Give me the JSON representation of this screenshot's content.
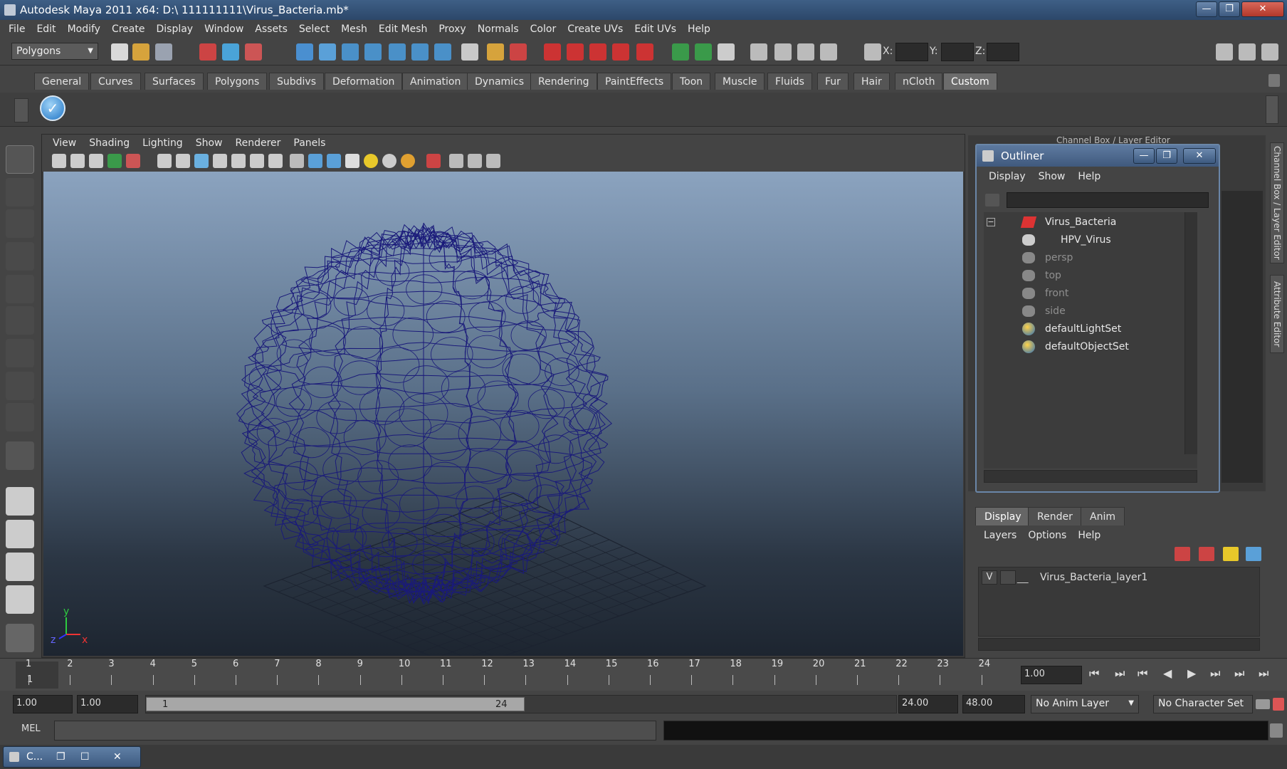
{
  "window": {
    "title": "Autodesk Maya 2011 x64: D:\\ 111111111\\Virus_Bacteria.mb*",
    "minimize": "—",
    "maximize": "❐",
    "close": "✕"
  },
  "menubar": [
    "File",
    "Edit",
    "Modify",
    "Create",
    "Display",
    "Window",
    "Assets",
    "Select",
    "Mesh",
    "Edit Mesh",
    "Proxy",
    "Normals",
    "Color",
    "Create UVs",
    "Edit UVs",
    "Help"
  ],
  "statusline": {
    "mode": "Polygons",
    "x_label": "X:",
    "y_label": "Y:",
    "z_label": "Z:"
  },
  "shelf_tabs": [
    "General",
    "Curves",
    "Surfaces",
    "Polygons",
    "Subdivs",
    "Deformation",
    "Animation",
    "Dynamics",
    "Rendering",
    "PaintEffects",
    "Toon",
    "Muscle",
    "Fluids",
    "Fur",
    "Hair",
    "nCloth",
    "Custom"
  ],
  "shelf_active": "Custom",
  "viewport": {
    "menu": [
      "View",
      "Shading",
      "Lighting",
      "Show",
      "Renderer",
      "Panels"
    ],
    "axis_y": "y",
    "axis_z": "z",
    "axis_x": "x",
    "wire_color": "#1a1a7a"
  },
  "channel_box_title": "Channel Box / Layer Editor",
  "side_tabs": [
    "Channel Box / Layer Editor",
    "Attribute Editor"
  ],
  "outliner": {
    "title": "Outliner",
    "menu": [
      "Display",
      "Show",
      "Help"
    ],
    "items": [
      {
        "label": "Virus_Bacteria",
        "dim": false
      },
      {
        "label": "HPV_Virus",
        "dim": false
      },
      {
        "label": "persp",
        "dim": true
      },
      {
        "label": "top",
        "dim": true
      },
      {
        "label": "front",
        "dim": true
      },
      {
        "label": "side",
        "dim": true
      },
      {
        "label": "defaultLightSet",
        "dim": false
      },
      {
        "label": "defaultObjectSet",
        "dim": false
      }
    ]
  },
  "layer_editor": {
    "tabs": [
      "Display",
      "Render",
      "Anim"
    ],
    "menu": [
      "Layers",
      "Options",
      "Help"
    ],
    "layer_visible": "V",
    "layer_name": "Virus_Bacteria_layer1"
  },
  "timeline": {
    "ticks": [
      "1",
      "2",
      "3",
      "4",
      "5",
      "6",
      "7",
      "8",
      "9",
      "10",
      "11",
      "12",
      "13",
      "14",
      "15",
      "16",
      "17",
      "18",
      "19",
      "20",
      "21",
      "22",
      "23",
      "24"
    ],
    "current_marker": "1",
    "current_time": "1.00"
  },
  "range": {
    "start_time": "1.00",
    "playback_start": "1.00",
    "slider_start": "1",
    "slider_end": "24",
    "playback_end": "24.00",
    "end_time": "48.00",
    "anim_layer": "No Anim Layer",
    "character_set": "No Character Set"
  },
  "command_line": {
    "label": "MEL"
  },
  "taskbar": {
    "label": "C...",
    "restore": "❐",
    "maximize": "☐",
    "close": "✕"
  }
}
